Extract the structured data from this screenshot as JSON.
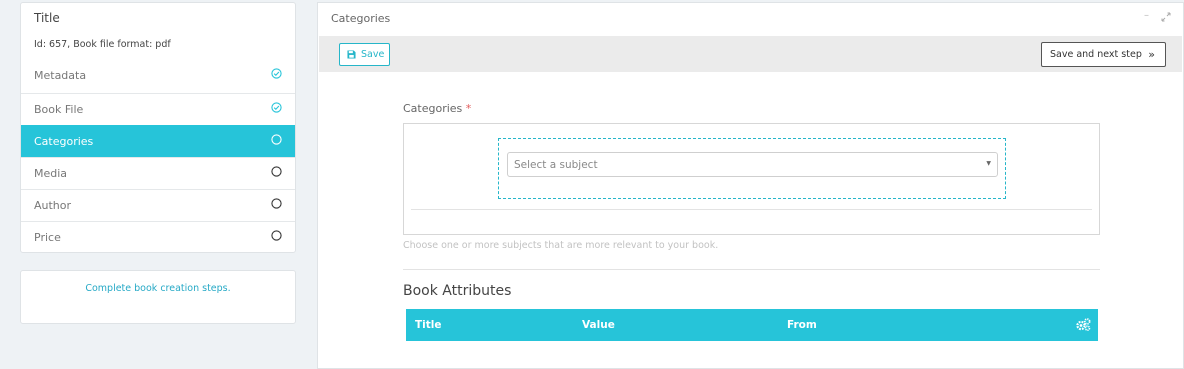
{
  "sidebar": {
    "title": "Title",
    "subtitle": "Id: 657, Book file format: pdf",
    "steps": [
      {
        "label": "Metadata",
        "status": "done"
      },
      {
        "label": "Book File",
        "status": "done"
      },
      {
        "label": "Categories",
        "status": "active"
      },
      {
        "label": "Media",
        "status": "pending"
      },
      {
        "label": "Author",
        "status": "pending"
      },
      {
        "label": "Price",
        "status": "pending"
      }
    ],
    "note": "Complete book creation steps."
  },
  "main": {
    "title": "Categories",
    "toolbar": {
      "save_label": "Save",
      "next_label": "Save and next step"
    },
    "categories": {
      "label": "Categories",
      "required_mark": "*",
      "placeholder": "Select a subject",
      "help": "Choose one or more subjects that are more relevant to your book."
    },
    "attributes": {
      "title": "Book Attributes",
      "columns": [
        "Title",
        "Value",
        "From"
      ]
    }
  },
  "colors": {
    "accent": "#26c4d9",
    "accent_text": "#26a9c6",
    "required": "#e25a5a"
  },
  "icons": {
    "done": "check-circle-icon",
    "pending": "circle-icon",
    "save": "floppy-disk-icon",
    "next": "double-chevron-right-icon",
    "settings": "gears-icon",
    "minimize": "minimize-icon",
    "expand": "expand-icon"
  }
}
